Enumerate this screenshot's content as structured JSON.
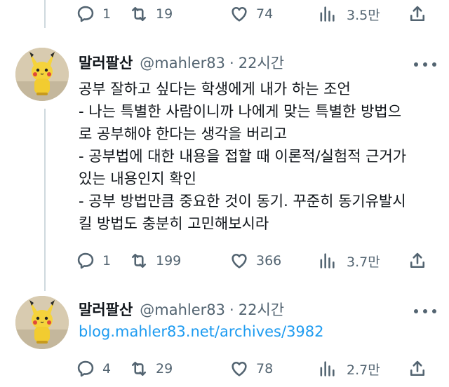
{
  "top_actions": {
    "replies": "1",
    "retweets": "19",
    "likes": "74",
    "views": "3.5만"
  },
  "tweets": [
    {
      "name": "말러팔산",
      "handle": "@mahler83",
      "separator": "·",
      "time": "22시간",
      "lines": [
        "공부 잘하고 싶다는 학생에게 내가 하는 조언",
        "- 나는 특별한 사람이니까 나에게 맞는 특별한 방법으",
        "로 공부해야 한다는 생각을 버리고",
        "- 공부법에 대한 내용을 접할 때 이론적/실험적 근거가",
        "있는 내용인지 확인",
        "- 공부 방법만큼 중요한 것이 동기. 꾸준히 동기유발시",
        "킬 방법도 충분히 고민해보시라"
      ],
      "actions": {
        "replies": "1",
        "retweets": "199",
        "likes": "366",
        "views": "3.7만"
      }
    },
    {
      "name": "말러팔산",
      "handle": "@mahler83",
      "separator": "·",
      "time": "22시간",
      "link_text": "blog.mahler83.net/archives/3982",
      "actions": {
        "replies": "4",
        "retweets": "29",
        "likes": "78",
        "views": "2.7만"
      }
    }
  ]
}
